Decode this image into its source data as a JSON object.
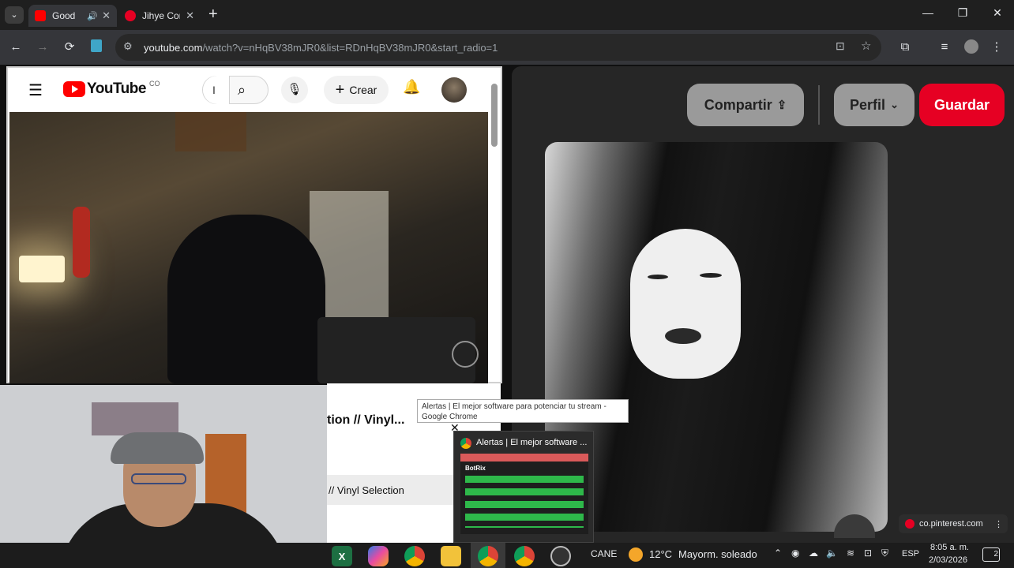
{
  "tabs": [
    {
      "title": "Good",
      "favicon_color": "#ff0000"
    },
    {
      "title": "Jihye Cor",
      "favicon_color": "#e60023"
    }
  ],
  "address": {
    "host": "youtube.com",
    "path": "/watch?v=nHqBV38mJR0&list=RDnHqBV38mJR0&start_radio=1"
  },
  "youtube": {
    "logo_text": "YouTube",
    "country_code": "CO",
    "search_placeholder": "I",
    "create_label": "Crear",
    "video_title_partial": "tion // Vinyl...",
    "playlist_item": "// Vinyl Selection"
  },
  "pinterest": {
    "share_label": "Compartir",
    "profile_label": "Perfil",
    "save_label": "Guardar",
    "site_label": "co.pinterest.com",
    "accent": "#e60023"
  },
  "tooltip": {
    "line1": "Alertas | El mejor software para potenciar tu stream -",
    "line2": "Google Chrome"
  },
  "thumbnail_preview": {
    "title": "Alertas | El mejor software ...",
    "brand": "BotRix"
  },
  "taskbar": {
    "stock": "CANE",
    "temperature": "12°C",
    "weather": "Mayorm. soleado",
    "language": "ESP",
    "time": "8:05 a. m.",
    "date": "2/03/2026",
    "notif_count": "2"
  }
}
